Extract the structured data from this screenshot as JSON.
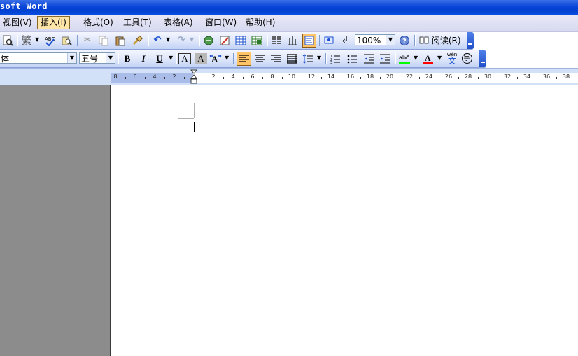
{
  "title": "soft Word",
  "menu": [
    {
      "label": "视图(V)"
    },
    {
      "label": "插入(I)"
    },
    {
      "label": "格式(O)"
    },
    {
      "label": "工具(T)"
    },
    {
      "label": "表格(A)"
    },
    {
      "label": "窗口(W)"
    },
    {
      "label": "帮助(H)"
    }
  ],
  "standard_toolbar": {
    "zoom": "100%",
    "read_label": "阅读(R)"
  },
  "format_toolbar": {
    "font": "体",
    "size": "五号",
    "bold": "B",
    "italic": "I",
    "underline": "U",
    "char_border": "A",
    "char_shading": "A",
    "phonetic": "wén",
    "phonetic_char": "文",
    "encircle_char": "字"
  },
  "ruler": {
    "left_numbers": [
      "8",
      "6",
      "4",
      "2"
    ],
    "right_numbers": [
      "2",
      "4",
      "6",
      "8",
      "10",
      "12",
      "14",
      "16",
      "18",
      "20",
      "22",
      "24",
      "26",
      "28",
      "30",
      "32",
      "34",
      "36",
      "38"
    ]
  },
  "colors": {
    "title_bar": "#0a46d8",
    "active_menu": "#ffe6a8",
    "highlight_color": "#00ff00",
    "font_color": "#ff0000"
  }
}
